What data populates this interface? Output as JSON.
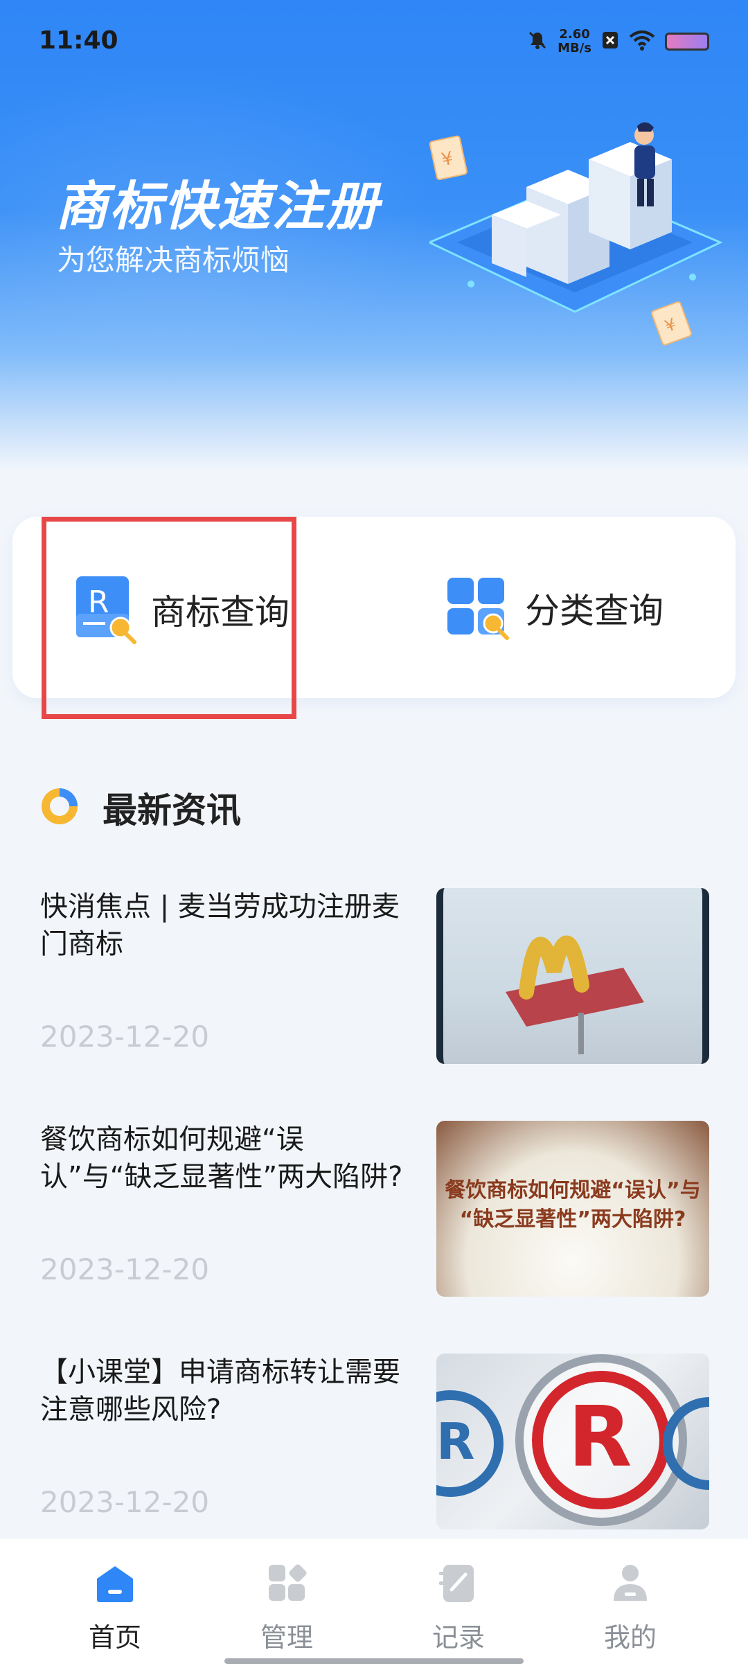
{
  "status_bar": {
    "time": "11:40",
    "net_speed_value": "2.60",
    "net_speed_unit": "MB/s",
    "icons": [
      "bell-mute-icon",
      "close-box-icon",
      "wifi-icon",
      "battery-icon"
    ]
  },
  "hero": {
    "title": "商标快速注册",
    "subtitle": "为您解决商标烦恼",
    "colors": {
      "gradient_top": "#2f86f6",
      "text": "#ffffff"
    }
  },
  "query": {
    "items": [
      {
        "label": "商标查询",
        "icon": "trademark-search-icon"
      },
      {
        "label": "分类查询",
        "icon": "category-search-icon"
      }
    ],
    "highlight_color": "#e84747"
  },
  "news": {
    "section_title": "最新资讯",
    "items": [
      {
        "title": "快消焦点 | 麦当劳成功注册麦门商标",
        "date": "2023-12-20",
        "thumb": "mcdonalds-sign-image"
      },
      {
        "title": "餐饮商标如何规避“误认”与“缺乏显著性”两大陷阱?",
        "date": "2023-12-20",
        "thumb": "rice-image",
        "thumb_text_1": "餐饮商标如何规避“误认”与",
        "thumb_text_2": "“缺乏显著性”两大陷阱?"
      },
      {
        "title": "【小课堂】申请商标转让需要注意哪些风险?",
        "date": "2023-12-20",
        "thumb": "registered-mark-magnifier-image",
        "thumb_glyph": "R"
      }
    ]
  },
  "bottom_nav": {
    "items": [
      {
        "label": "首页",
        "icon": "home-icon",
        "active": true
      },
      {
        "label": "管理",
        "icon": "manage-icon",
        "active": false
      },
      {
        "label": "记录",
        "icon": "record-icon",
        "active": false
      },
      {
        "label": "我的",
        "icon": "profile-icon",
        "active": false
      }
    ],
    "active_color": "#2f86f6",
    "inactive_color": "#c9ccd1"
  }
}
